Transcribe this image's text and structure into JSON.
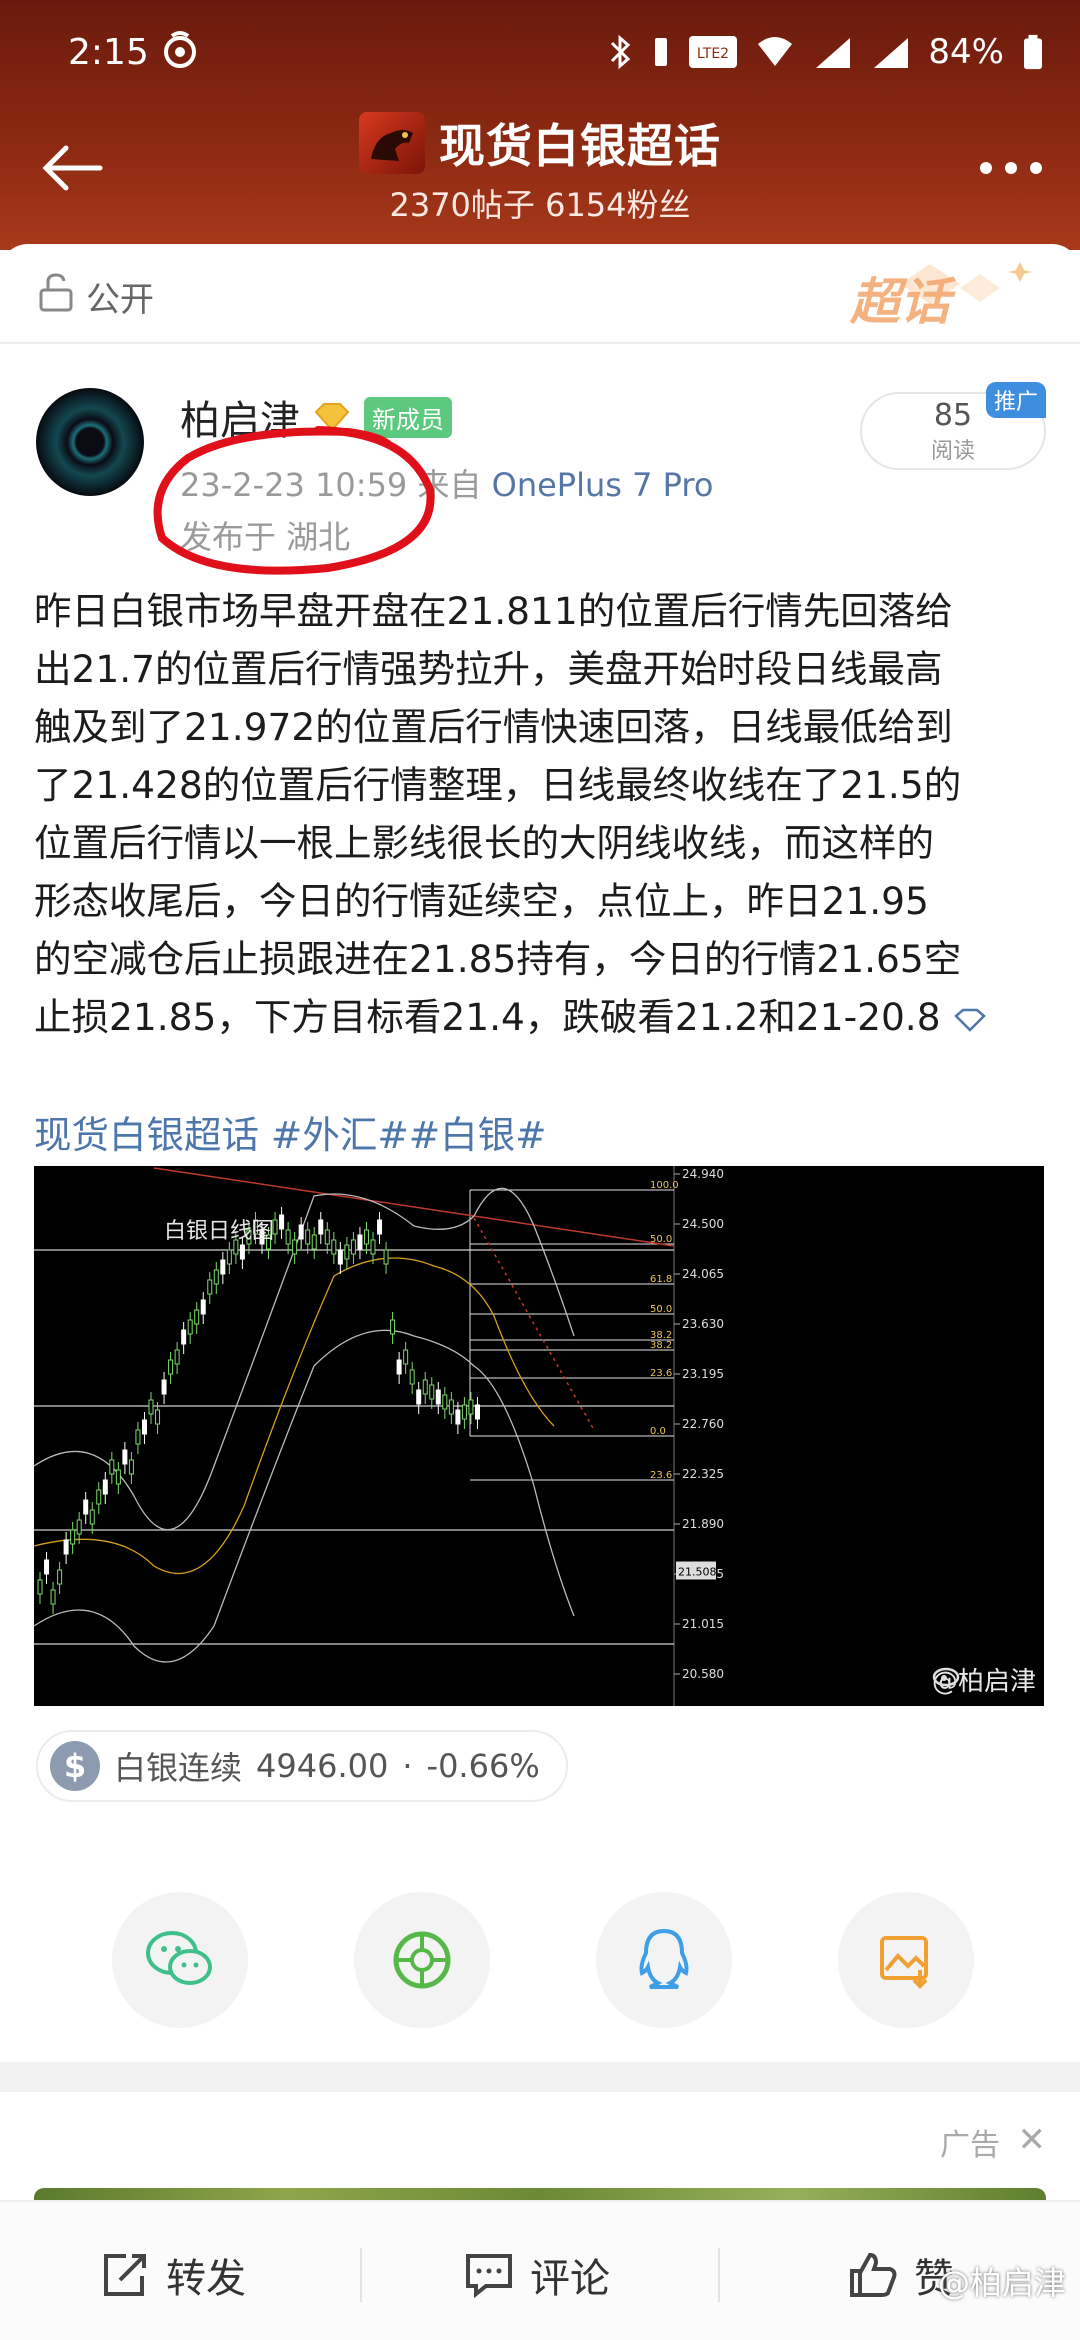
{
  "status_bar": {
    "time": "2:15",
    "battery": "84%"
  },
  "header": {
    "title": "现货白银超话",
    "subtitle": "2370帖子 6154粉丝"
  },
  "visibility": {
    "label": "公开",
    "brand": "超话"
  },
  "post": {
    "author": "柏启津",
    "new_member_badge": "新成员",
    "timestamp": "23-2-23 10:59",
    "source_prefix": "来自",
    "device": "OnePlus 7 Pro",
    "location": "发布于 湖北",
    "reads_count": "85",
    "reads_label": "阅读",
    "promo_label": "推广",
    "body_lines": [
      "昨日白银市场早盘开盘在21.811的位置后行情先回落给",
      "出21.7的位置后行情强势拉升，美盘开始时段日线最高",
      "触及到了21.972的位置后行情快速回落，日线最低给到",
      "了21.428的位置后行情整理，日线最终收线在了21.5的",
      "位置后行情以一根上影线很长的大阴线收线，而这样的",
      "形态收尾后，今日的行情延续空，点位上，昨日21.95",
      "的空减仓后止损跟进在21.85持有，今日的行情21.65空",
      "止损21.85，下方目标看21.4，跌破看21.2和21-20.8"
    ],
    "tags": "现货白银超话 #外汇##白银#"
  },
  "chart_data": {
    "type": "candlestick",
    "title": "白银日线图",
    "price_axis": [
      "24.940",
      "24.500",
      "24.065",
      "23.630",
      "23.195",
      "22.760",
      "22.325",
      "21.890",
      "21.455",
      "21.015",
      "20.580"
    ],
    "current_price": "21.508",
    "fib_levels": [
      "100.0",
      "50.0",
      "61.8",
      "50.0",
      "38.2",
      "38.2",
      "23.6",
      "0.0",
      "23.6"
    ],
    "watermark": "@柏启津"
  },
  "ticker": {
    "name": "白银连续",
    "price": "4946.00",
    "change": "-0.66%"
  },
  "ad": {
    "label": "广告"
  },
  "bottom_bar": {
    "repost": "转发",
    "comment": "评论",
    "like": "赞",
    "watermark": "@柏启津"
  }
}
